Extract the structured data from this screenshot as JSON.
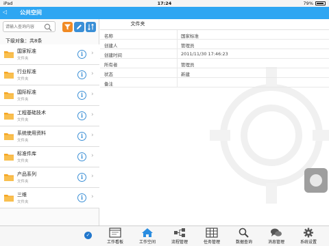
{
  "status": {
    "device": "iPad",
    "time": "17:24",
    "battery": "79%"
  },
  "nav": {
    "back": "◁",
    "title": "公共空间"
  },
  "search": {
    "placeholder": "请输入查询内容"
  },
  "list": {
    "count_label": "下级对象：共8条",
    "items": [
      {
        "name": "国家标准",
        "type": "文件夹"
      },
      {
        "name": "行业标准",
        "type": "文件夹"
      },
      {
        "name": "国际标准",
        "type": "文件夹"
      },
      {
        "name": "工程基础技术",
        "type": "文件夹"
      },
      {
        "name": "系统使用资料",
        "type": "文件夹"
      },
      {
        "name": "标准件库",
        "type": "文件夹"
      },
      {
        "name": "产品系列",
        "type": "文件夹"
      },
      {
        "name": "三维",
        "type": "文件夹"
      }
    ]
  },
  "detail": {
    "header": "文件夹",
    "rows": [
      {
        "key": "名称",
        "value": "国家标准"
      },
      {
        "key": "创建人",
        "value": "管理员"
      },
      {
        "key": "创建时间",
        "value": "2011/11/30 17:46:23"
      },
      {
        "key": "所有者",
        "value": "管理员"
      },
      {
        "key": "状态",
        "value": "新建"
      },
      {
        "key": "备注",
        "value": ""
      }
    ]
  },
  "tabs": [
    {
      "label": "工作看板",
      "icon": "dashboard-icon"
    },
    {
      "label": "工作空间",
      "icon": "home-icon"
    },
    {
      "label": "流程管理",
      "icon": "workflow-icon"
    },
    {
      "label": "任务管理",
      "icon": "task-grid-icon"
    },
    {
      "label": "数据查询",
      "icon": "search-icon"
    },
    {
      "label": "消息管理",
      "icon": "chat-icon"
    },
    {
      "label": "系统设置",
      "icon": "gear-icon"
    }
  ],
  "colors": {
    "nav_blue": "#2ea6f2",
    "folder_orange": "#f5a623",
    "info_blue": "#3a8fd6",
    "active_tab": "#2a8de0"
  }
}
